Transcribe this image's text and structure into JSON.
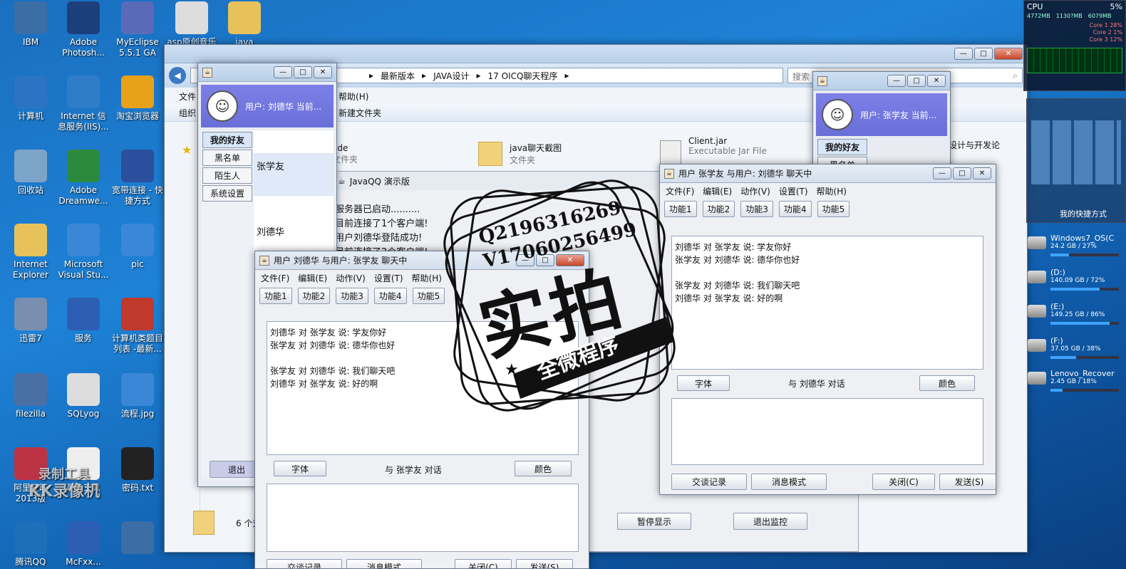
{
  "desktop_icons": [
    {
      "label": "IBM",
      "name": "ibm-icon"
    },
    {
      "label": "Adobe Photosh...",
      "name": "photoshop-icon"
    },
    {
      "label": "MyEclipse 5.5.1 GA",
      "name": "myeclipse-icon"
    },
    {
      "label": "asp原创音乐网",
      "name": "asp-music-icon"
    },
    {
      "label": "java",
      "name": "java-folder-icon"
    },
    {
      "label": "计算机",
      "name": "computer-icon"
    },
    {
      "label": "Internet 信息服务(IIS)...",
      "name": "iis-icon"
    },
    {
      "label": "淘宝浏览器",
      "name": "taobao-browser-icon"
    },
    {
      "label": "回收站",
      "name": "recycle-bin-icon"
    },
    {
      "label": "Adobe Dreamwe...",
      "name": "dreamweaver-icon"
    },
    {
      "label": "宽带连接 - 快捷方式",
      "name": "broadband-icon"
    },
    {
      "label": "Internet Explorer",
      "name": "ie-icon"
    },
    {
      "label": "Microsoft Visual Stu...",
      "name": "visual-studio-icon"
    },
    {
      "label": "pic",
      "name": "pic-folder-icon"
    },
    {
      "label": "迅雷7",
      "name": "xunlei-icon"
    },
    {
      "label": "服务",
      "name": "services-icon"
    },
    {
      "label": "计算机类题目列表 -最新...",
      "name": "word-doc-icon"
    },
    {
      "label": "filezilla",
      "name": "filezilla-icon"
    },
    {
      "label": "SQLyog",
      "name": "sqlyog-icon"
    },
    {
      "label": "流程.jpg",
      "name": "image-file-icon"
    },
    {
      "label": "阿里旺旺2013版",
      "name": "aliwangwang-icon"
    },
    {
      "label": "录像工具",
      "name": "recorder-icon"
    },
    {
      "label": "密码.txt",
      "name": "text-file-icon"
    },
    {
      "label": "腾讯QQ",
      "name": "qq-icon"
    },
    {
      "label": "McFxx...",
      "name": "mcafee-icon"
    },
    {
      "label": "",
      "name": "word-doc-icon-2"
    }
  ],
  "watermark": {
    "line1": "录制工具",
    "line2": "KK录像机"
  },
  "explorer": {
    "breadcrumb": [
      "最新版本",
      "JAVA设计",
      "17 OICQ聊天程序"
    ],
    "search_placeholder": "搜索",
    "menu": [
      "文件",
      "帮助(H)"
    ],
    "toolbar": [
      "组织",
      "新建文件夹"
    ],
    "files": [
      {
        "name": "ode",
        "type": "文件夹"
      },
      {
        "name": "java聊天截图",
        "type": "文件夹"
      },
      {
        "name": "Client.jar",
        "type": "Executable Jar File"
      }
    ],
    "status": "6 个对象",
    "side_text": "设计与开发论"
  },
  "server": {
    "title": "JavaQQ 演示版",
    "log": [
      "服务器已启动..........",
      "目前连接了1个客户端!",
      "用户刘德华登陆成功!",
      "目前连接了2个客户端!"
    ],
    "pause_button": "暂停显示",
    "exit_button": "退出监控"
  },
  "client1": {
    "user_title": "用户: 刘德华 当前...",
    "tabs": [
      "我的好友",
      "黑名单",
      "陌生人",
      "系统设置"
    ],
    "friends": [
      "张学友",
      "刘德华"
    ],
    "exit_button": "退出"
  },
  "client2": {
    "user_title": "用户: 张学友 当前...",
    "tabs": [
      "我的好友",
      "黑名单"
    ]
  },
  "chat1": {
    "title": "用户 刘德华 与用户: 张学友 聊天中",
    "menu": [
      "文件(F)",
      "编辑(E)",
      "动作(V)",
      "设置(T)",
      "帮助(H)"
    ],
    "functions": [
      "功能1",
      "功能2",
      "功能3",
      "功能4",
      "功能5"
    ],
    "messages": [
      "刘德华 对 张学友 说: 学友你好",
      "张学友 对 刘德华 说: 德华你也好",
      "",
      "张学友 对 刘德华 说: 我们聊天吧",
      "刘德华 对 张学友 说: 好的啊"
    ],
    "font_button": "字体",
    "talk_label": "与 张学友 对话",
    "color_button": "颜色",
    "bottom_buttons": [
      "交谈记录",
      "消息模式",
      "关闭(C)",
      "发送(S)"
    ]
  },
  "chat2": {
    "title": "用户 张学友 与用户: 刘德华 聊天中",
    "menu": [
      "文件(F)",
      "编辑(E)",
      "动作(V)",
      "设置(T)",
      "帮助(H)"
    ],
    "functions": [
      "功能1",
      "功能2",
      "功能3",
      "功能4",
      "功能5"
    ],
    "messages": [
      "刘德华 对 张学友 说: 学友你好",
      "张学友 对 刘德华 说: 德华你也好",
      "",
      "张学友 对 刘德华 说: 我们聊天吧",
      "刘德华 对 张学友 说: 好的啊"
    ],
    "font_button": "字体",
    "talk_label": "与 刘德华 对话",
    "color_button": "颜色",
    "bottom_buttons": [
      "交谈记录",
      "消息模式",
      "关闭(C)",
      "发送(S)"
    ]
  },
  "stamp": {
    "qq": "Q2196316269",
    "wechat": "V17060256499",
    "big": "实拍",
    "banner": "全微程序"
  },
  "gadget": {
    "cpu_label": "CPU",
    "cpu_value": "5%",
    "mem_used": "4772MB",
    "mem_free": "1130?MB",
    "mem_total": "6079MB",
    "cores": [
      {
        "name": "Core 1",
        "value": "28%"
      },
      {
        "name": "Core 2",
        "value": "1%"
      },
      {
        "name": "Core 3",
        "value": "12%"
      }
    ],
    "shortcut_label": "我的快捷方式"
  },
  "drives": [
    {
      "name": "Windows7_OS(C",
      "info": "24.2 GB / 27%",
      "pct": 27
    },
    {
      "name": "(D:)",
      "info": "140.09 GB / 72%",
      "pct": 72
    },
    {
      "name": "(E:)",
      "info": "149.25 GB / 86%",
      "pct": 86
    },
    {
      "name": "(F:)",
      "info": "37.05 GB / 38%",
      "pct": 38
    },
    {
      "name": "Lenovo_Recover",
      "info": "2.45 GB / 18%",
      "pct": 18
    }
  ]
}
